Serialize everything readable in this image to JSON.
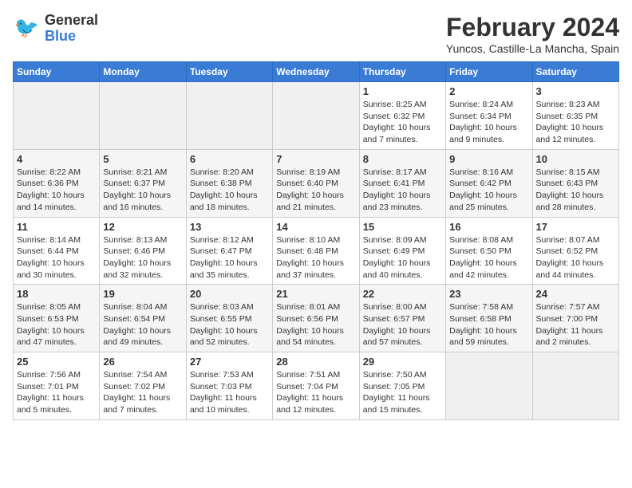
{
  "logo": {
    "text1": "General",
    "text2": "Blue"
  },
  "title": "February 2024",
  "location": "Yuncos, Castille-La Mancha, Spain",
  "days_of_week": [
    "Sunday",
    "Monday",
    "Tuesday",
    "Wednesday",
    "Thursday",
    "Friday",
    "Saturday"
  ],
  "weeks": [
    [
      {
        "day": "",
        "info": ""
      },
      {
        "day": "",
        "info": ""
      },
      {
        "day": "",
        "info": ""
      },
      {
        "day": "",
        "info": ""
      },
      {
        "day": "1",
        "info": "Sunrise: 8:25 AM\nSunset: 6:32 PM\nDaylight: 10 hours\nand 7 minutes."
      },
      {
        "day": "2",
        "info": "Sunrise: 8:24 AM\nSunset: 6:34 PM\nDaylight: 10 hours\nand 9 minutes."
      },
      {
        "day": "3",
        "info": "Sunrise: 8:23 AM\nSunset: 6:35 PM\nDaylight: 10 hours\nand 12 minutes."
      }
    ],
    [
      {
        "day": "4",
        "info": "Sunrise: 8:22 AM\nSunset: 6:36 PM\nDaylight: 10 hours\nand 14 minutes."
      },
      {
        "day": "5",
        "info": "Sunrise: 8:21 AM\nSunset: 6:37 PM\nDaylight: 10 hours\nand 16 minutes."
      },
      {
        "day": "6",
        "info": "Sunrise: 8:20 AM\nSunset: 6:38 PM\nDaylight: 10 hours\nand 18 minutes."
      },
      {
        "day": "7",
        "info": "Sunrise: 8:19 AM\nSunset: 6:40 PM\nDaylight: 10 hours\nand 21 minutes."
      },
      {
        "day": "8",
        "info": "Sunrise: 8:17 AM\nSunset: 6:41 PM\nDaylight: 10 hours\nand 23 minutes."
      },
      {
        "day": "9",
        "info": "Sunrise: 8:16 AM\nSunset: 6:42 PM\nDaylight: 10 hours\nand 25 minutes."
      },
      {
        "day": "10",
        "info": "Sunrise: 8:15 AM\nSunset: 6:43 PM\nDaylight: 10 hours\nand 28 minutes."
      }
    ],
    [
      {
        "day": "11",
        "info": "Sunrise: 8:14 AM\nSunset: 6:44 PM\nDaylight: 10 hours\nand 30 minutes."
      },
      {
        "day": "12",
        "info": "Sunrise: 8:13 AM\nSunset: 6:46 PM\nDaylight: 10 hours\nand 32 minutes."
      },
      {
        "day": "13",
        "info": "Sunrise: 8:12 AM\nSunset: 6:47 PM\nDaylight: 10 hours\nand 35 minutes."
      },
      {
        "day": "14",
        "info": "Sunrise: 8:10 AM\nSunset: 6:48 PM\nDaylight: 10 hours\nand 37 minutes."
      },
      {
        "day": "15",
        "info": "Sunrise: 8:09 AM\nSunset: 6:49 PM\nDaylight: 10 hours\nand 40 minutes."
      },
      {
        "day": "16",
        "info": "Sunrise: 8:08 AM\nSunset: 6:50 PM\nDaylight: 10 hours\nand 42 minutes."
      },
      {
        "day": "17",
        "info": "Sunrise: 8:07 AM\nSunset: 6:52 PM\nDaylight: 10 hours\nand 44 minutes."
      }
    ],
    [
      {
        "day": "18",
        "info": "Sunrise: 8:05 AM\nSunset: 6:53 PM\nDaylight: 10 hours\nand 47 minutes."
      },
      {
        "day": "19",
        "info": "Sunrise: 8:04 AM\nSunset: 6:54 PM\nDaylight: 10 hours\nand 49 minutes."
      },
      {
        "day": "20",
        "info": "Sunrise: 8:03 AM\nSunset: 6:55 PM\nDaylight: 10 hours\nand 52 minutes."
      },
      {
        "day": "21",
        "info": "Sunrise: 8:01 AM\nSunset: 6:56 PM\nDaylight: 10 hours\nand 54 minutes."
      },
      {
        "day": "22",
        "info": "Sunrise: 8:00 AM\nSunset: 6:57 PM\nDaylight: 10 hours\nand 57 minutes."
      },
      {
        "day": "23",
        "info": "Sunrise: 7:58 AM\nSunset: 6:58 PM\nDaylight: 10 hours\nand 59 minutes."
      },
      {
        "day": "24",
        "info": "Sunrise: 7:57 AM\nSunset: 7:00 PM\nDaylight: 11 hours\nand 2 minutes."
      }
    ],
    [
      {
        "day": "25",
        "info": "Sunrise: 7:56 AM\nSunset: 7:01 PM\nDaylight: 11 hours\nand 5 minutes."
      },
      {
        "day": "26",
        "info": "Sunrise: 7:54 AM\nSunset: 7:02 PM\nDaylight: 11 hours\nand 7 minutes."
      },
      {
        "day": "27",
        "info": "Sunrise: 7:53 AM\nSunset: 7:03 PM\nDaylight: 11 hours\nand 10 minutes."
      },
      {
        "day": "28",
        "info": "Sunrise: 7:51 AM\nSunset: 7:04 PM\nDaylight: 11 hours\nand 12 minutes."
      },
      {
        "day": "29",
        "info": "Sunrise: 7:50 AM\nSunset: 7:05 PM\nDaylight: 11 hours\nand 15 minutes."
      },
      {
        "day": "",
        "info": ""
      },
      {
        "day": "",
        "info": ""
      }
    ]
  ]
}
